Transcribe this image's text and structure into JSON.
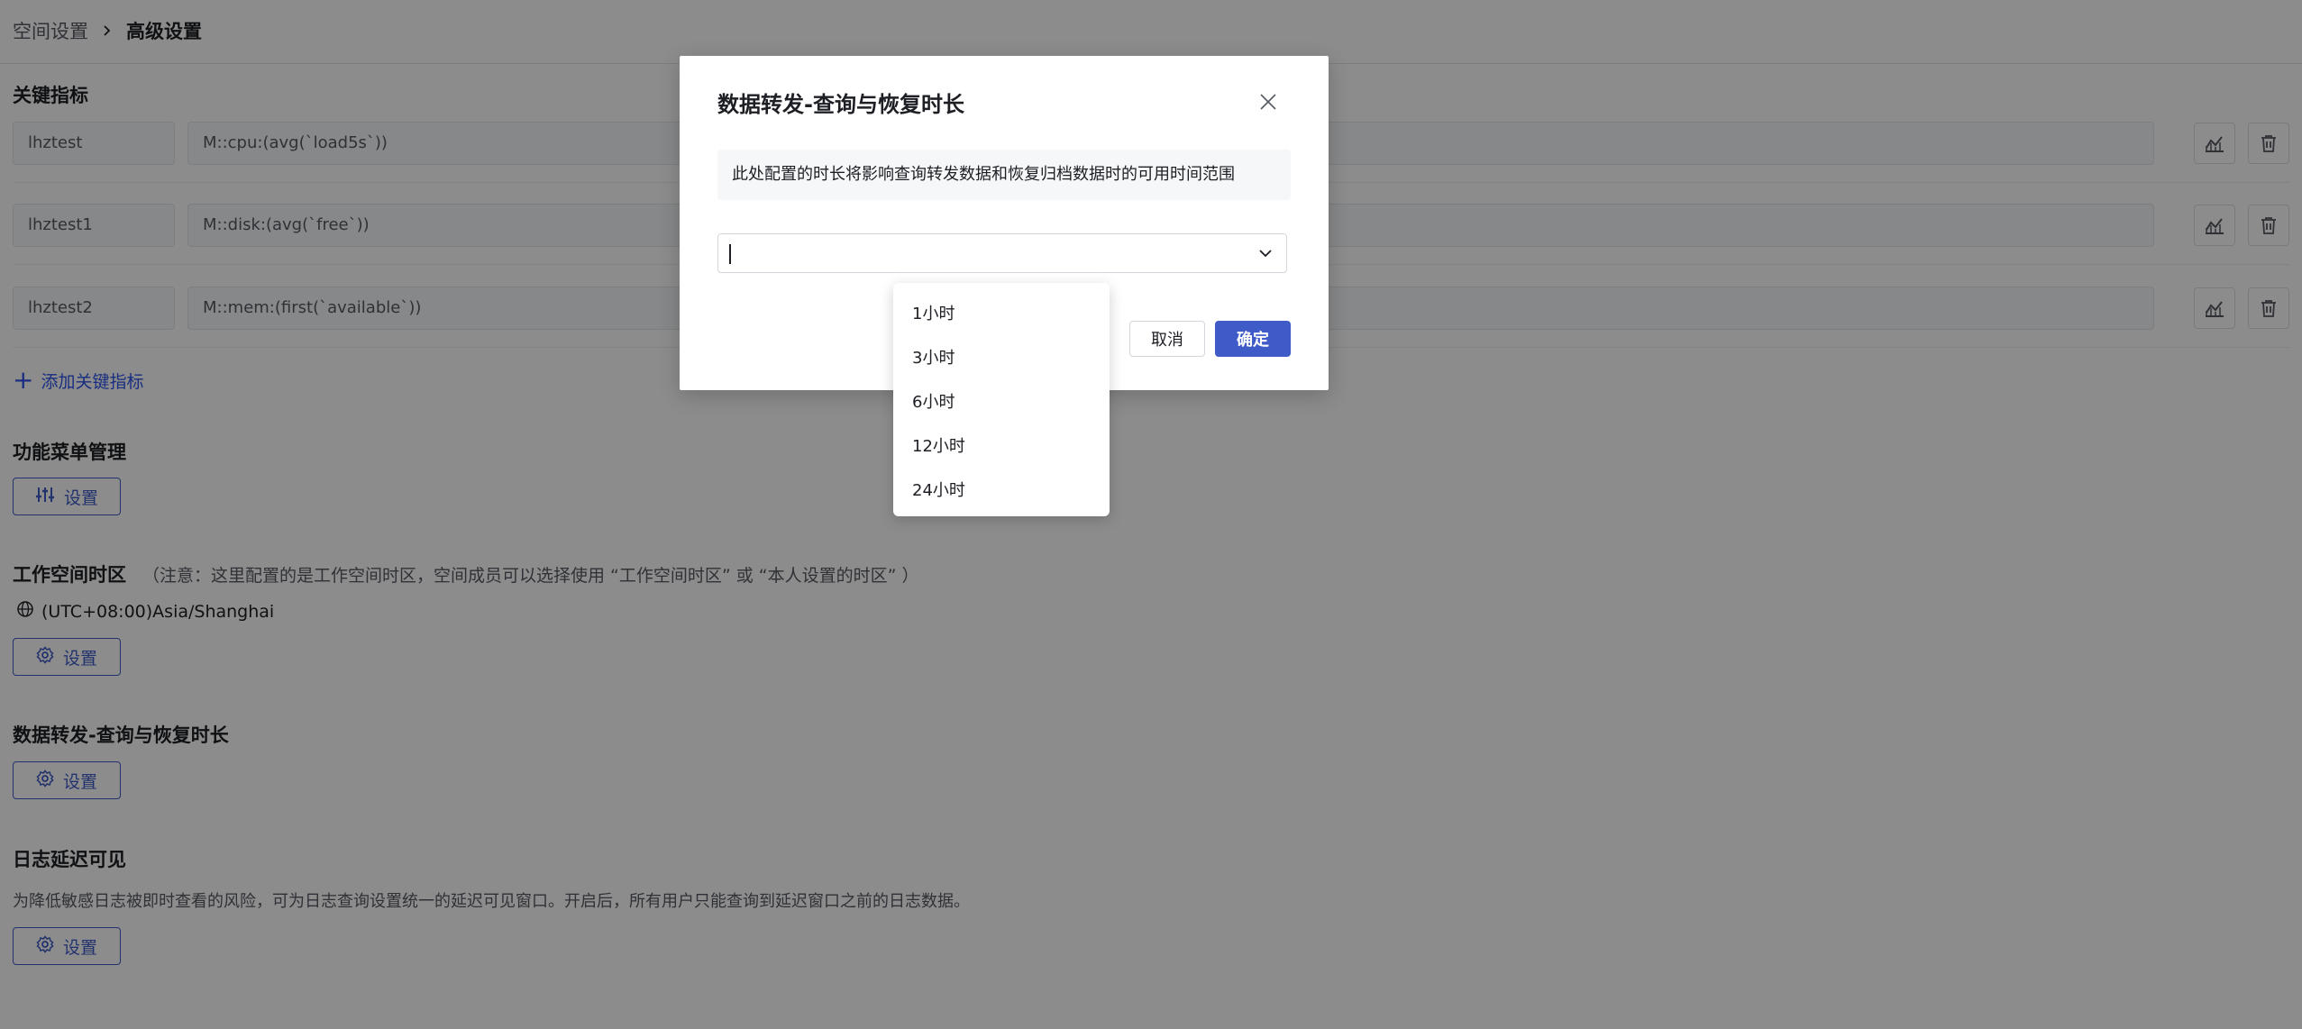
{
  "breadcrumb": {
    "parent": "空间设置",
    "current": "高级设置"
  },
  "key_metrics": {
    "title": "关键指标",
    "rows": [
      {
        "name": "lhztest",
        "expr": "M::cpu:(avg(`load5s`))"
      },
      {
        "name": "lhztest1",
        "expr": "M::disk:(avg(`free`))"
      },
      {
        "name": "lhztest2",
        "expr": "M::mem:(first(`available`))"
      }
    ],
    "add_label": "添加关键指标"
  },
  "menu_mgmt": {
    "title": "功能菜单管理",
    "button": "设置"
  },
  "timezone": {
    "title": "工作空间时区",
    "note": "（注意：这里配置的是工作空间时区，空间成员可以选择使用 “工作空间时区” 或 “本人设置的时区” ）",
    "value": "(UTC+08:00)Asia/Shanghai",
    "button": "设置"
  },
  "forwarding": {
    "title": "数据转发-查询与恢复时长",
    "button": "设置"
  },
  "log_delay": {
    "title": "日志延迟可见",
    "desc": "为降低敏感日志被即时查看的风险，可为日志查询设置统一的延迟可见窗口。开启后，所有用户只能查询到延迟窗口之前的日志数据。",
    "button": "设置"
  },
  "modal": {
    "title": "数据转发-查询与恢复时长",
    "note": "此处配置的时长将影响查询转发数据和恢复归档数据时的可用时间范围",
    "select_value": "",
    "cancel": "取消",
    "ok": "确定",
    "options": [
      "1小时",
      "3小时",
      "6小时",
      "12小时",
      "24小时"
    ]
  },
  "colors": {
    "primary": "#3e5bc7",
    "link": "#2f54eb",
    "mask": "rgba(0,0,0,0.45)"
  }
}
